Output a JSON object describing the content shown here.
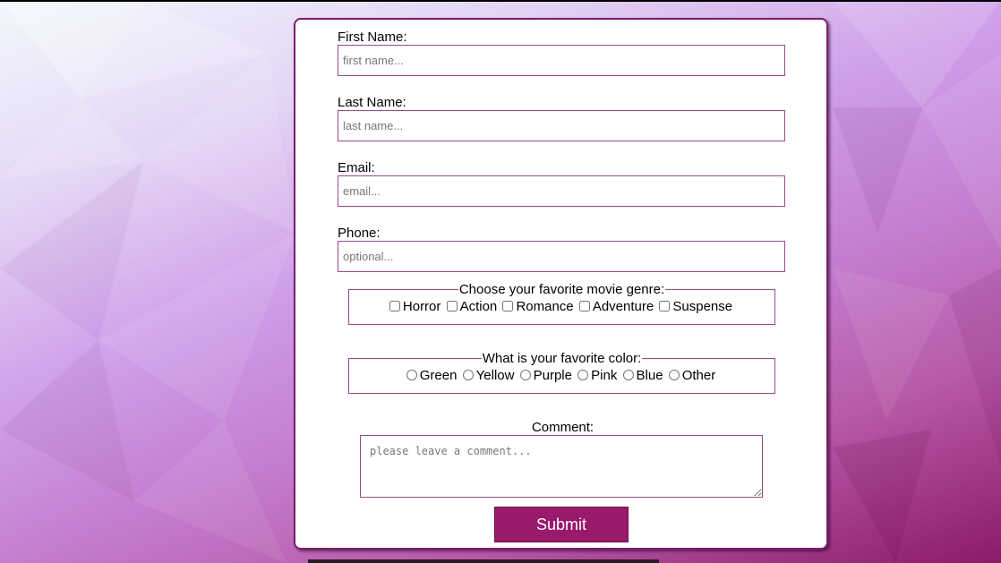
{
  "form": {
    "first_name": {
      "label": "First Name:",
      "placeholder": "first name..."
    },
    "last_name": {
      "label": "Last Name:",
      "placeholder": "last name..."
    },
    "email": {
      "label": "Email:",
      "placeholder": "email..."
    },
    "phone": {
      "label": "Phone:",
      "placeholder": "optional..."
    },
    "genre": {
      "legend": "Choose your favorite movie genre:",
      "options": [
        "Horror",
        "Action",
        "Romance",
        "Adventure",
        "Suspense"
      ]
    },
    "color": {
      "legend": "What is your favorite color:",
      "options": [
        "Green",
        "Yellow",
        "Purple",
        "Pink",
        "Blue",
        "Other"
      ]
    },
    "comment": {
      "label": "Comment:",
      "placeholder": "please leave a comment..."
    },
    "submit_label": "Submit"
  },
  "colors": {
    "accent": "#99196b",
    "card_border": "#7a1f6a",
    "input_border": "#9a4a8a"
  }
}
